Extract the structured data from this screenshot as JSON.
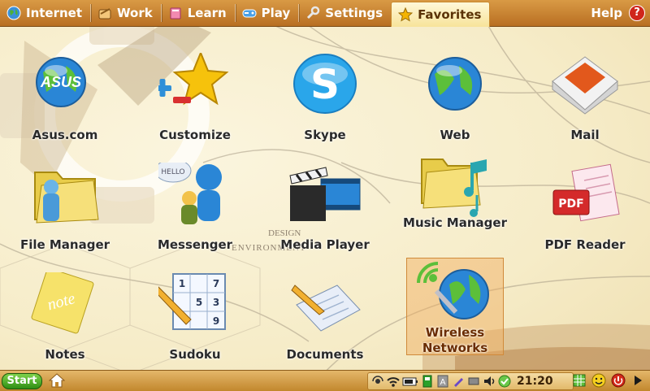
{
  "menu": {
    "tabs": [
      {
        "label": "Internet",
        "icon": "globe-icon"
      },
      {
        "label": "Work",
        "icon": "briefcase-icon"
      },
      {
        "label": "Learn",
        "icon": "book-icon"
      },
      {
        "label": "Play",
        "icon": "gamepad-icon"
      },
      {
        "label": "Settings",
        "icon": "wrench-icon"
      },
      {
        "label": "Favorites",
        "icon": "star-icon",
        "active": true
      }
    ],
    "help_label": "Help",
    "help_icon_text": "?"
  },
  "apps": [
    {
      "label": "Asus.com",
      "icon": "asus-globe-icon",
      "logo_text": "ASUS"
    },
    {
      "label": "Customize",
      "icon": "star-plus-minus-icon"
    },
    {
      "label": "Skype",
      "icon": "skype-icon",
      "logo_text": "S"
    },
    {
      "label": "Web",
      "icon": "globe-icon"
    },
    {
      "label": "Mail",
      "icon": "envelope-icon"
    },
    {
      "label": "File Manager",
      "icon": "folder-user-icon"
    },
    {
      "label": "Messenger",
      "icon": "messenger-icon",
      "bubble_text": "HELLO"
    },
    {
      "label": "Media Player",
      "icon": "clapperboard-icon"
    },
    {
      "label": "Music Manager",
      "icon": "music-folder-icon"
    },
    {
      "label": "PDF Reader",
      "icon": "pdf-icon",
      "badge_text": "PDF"
    },
    {
      "label": "Notes",
      "icon": "notepad-icon",
      "logo_text": "note"
    },
    {
      "label": "Sudoku",
      "icon": "sudoku-icon"
    },
    {
      "label": "Documents",
      "icon": "documents-icon"
    },
    {
      "label": "Wireless Networks",
      "icon": "wireless-globe-icon",
      "selected": true
    }
  ],
  "taskbar": {
    "start_label": "Start",
    "clock": "21:20",
    "tray_icons": [
      "network-icon",
      "wifi-icon",
      "battery-icon",
      "sd-card-icon",
      "keyboard-icon",
      "pen-icon",
      "device-icon",
      "volume-icon",
      "chat-icon"
    ],
    "right_icons": [
      "spreadsheet-icon",
      "smiley-icon",
      "power-icon",
      "arrow-right-icon"
    ]
  },
  "sudoku_digits": [
    "1",
    "7",
    "5",
    "3",
    "9"
  ],
  "background_text": [
    "DESIGN",
    "ENVIRONMENT"
  ]
}
